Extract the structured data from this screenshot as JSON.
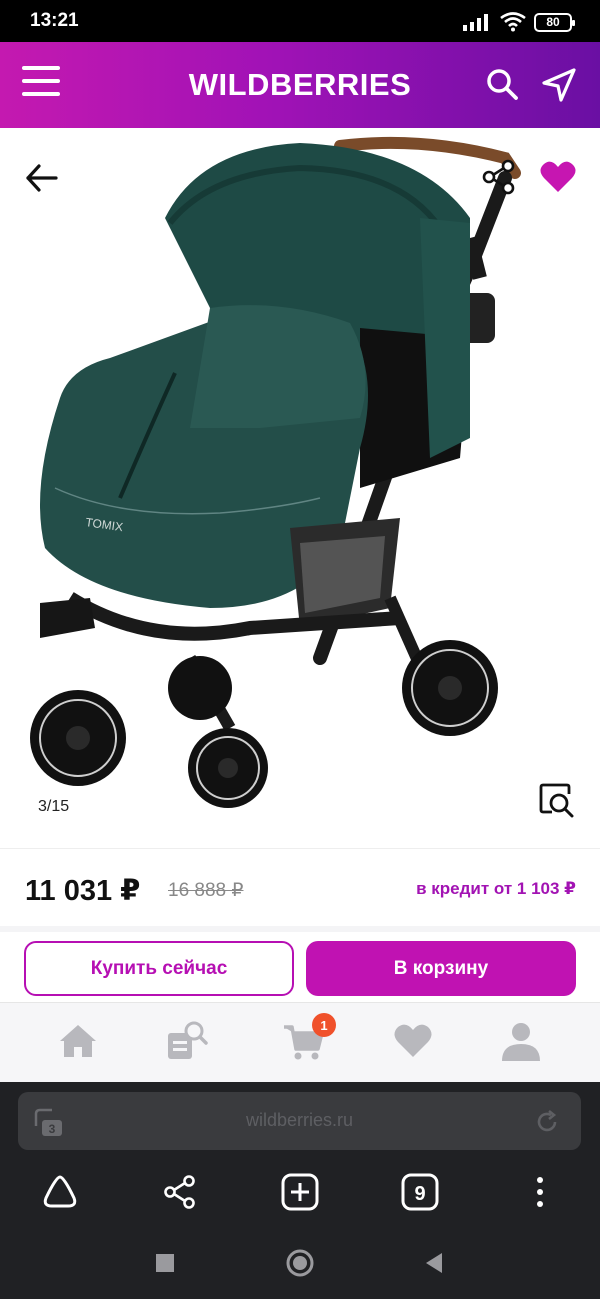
{
  "status_bar": {
    "time": "13:21",
    "battery": "80",
    "icons": [
      "signal-icon",
      "wifi-icon",
      "battery-icon"
    ]
  },
  "header": {
    "logo": "WILDBERRIES",
    "icons": [
      "menu-icon",
      "search-icon",
      "navigation-arrow-icon"
    ],
    "gradient": [
      "#c419b0",
      "#6a0fa3"
    ]
  },
  "gallery": {
    "counter": "3/15",
    "brand_on_product": "TOMIX",
    "icons": [
      "back-arrow-icon",
      "share-icon",
      "heart-icon",
      "zoom-search-icon"
    ],
    "favorite_color": "#c616b1"
  },
  "price": {
    "current": "11 031 ₽",
    "old": "16 888 ₽",
    "credit": "в кредит от 1 103 ₽"
  },
  "actions": {
    "buy_now": "Купить сейчас",
    "add_to_cart": "В корзину",
    "accent": "#c012b2"
  },
  "tabbar": {
    "items": [
      {
        "name": "home",
        "icon": "home-icon"
      },
      {
        "name": "catalog",
        "icon": "catalog-search-icon"
      },
      {
        "name": "cart",
        "icon": "cart-icon"
      },
      {
        "name": "favorites",
        "icon": "heart-icon"
      },
      {
        "name": "profile",
        "icon": "user-icon"
      }
    ],
    "cart_badge": "1"
  },
  "browser": {
    "url": "wildberries.ru",
    "small_tab_count": "3",
    "tabs_count": "9",
    "icons": [
      "home-triangle-icon",
      "share-icon",
      "new-tab-plus-icon",
      "tabs-icon",
      "more-vertical-icon"
    ]
  },
  "system_nav": {
    "icons": [
      "recents-square-icon",
      "home-circle-icon",
      "back-triangle-icon"
    ]
  }
}
